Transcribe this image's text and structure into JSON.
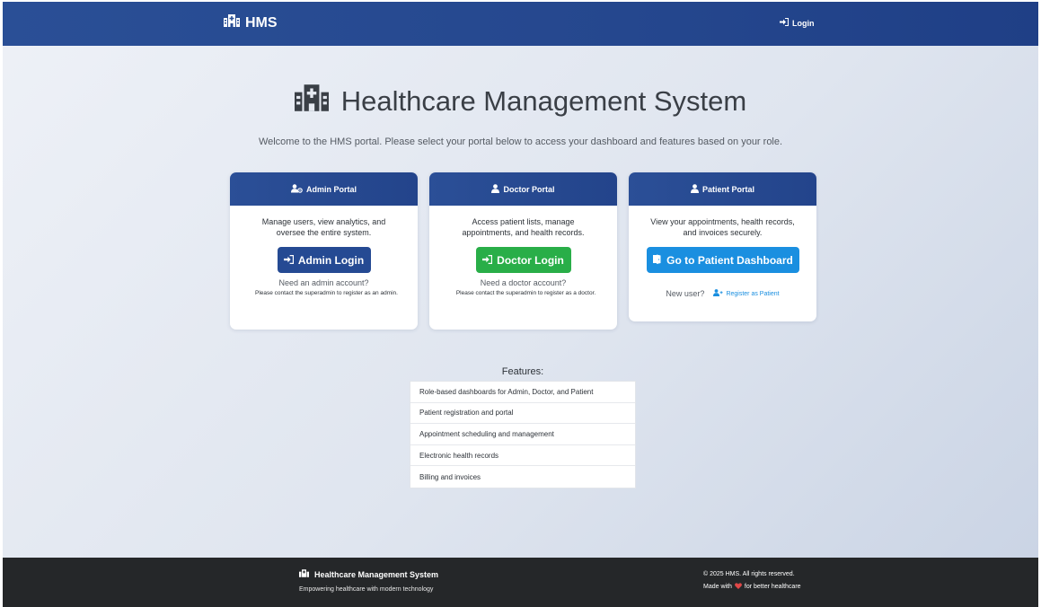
{
  "navbar": {
    "brand": "HMS",
    "brand_icon": "hospital-icon",
    "login_label": "Login",
    "login_icon": "sign-in-icon"
  },
  "hero": {
    "title": "Healthcare Management System",
    "subtitle": "Welcome to the HMS portal. Please select your portal below to access your dashboard and features based on your role."
  },
  "cards": {
    "admin": {
      "header": "Admin Portal",
      "icon": "user-gear-icon",
      "description": "Manage users, view analytics, and oversee the entire system.",
      "button_label": "Admin Login",
      "note": "Need an admin account?",
      "small": "Please contact the superadmin to register as an admin."
    },
    "doctor": {
      "header": "Doctor Portal",
      "icon": "user-doctor-icon",
      "description": "Access patient lists, manage appointments, and health records.",
      "button_label": "Doctor Login",
      "note": "Need a doctor account?",
      "small": "Please contact the superadmin to register as a doctor."
    },
    "patient": {
      "header": "Patient Portal",
      "icon": "user-icon",
      "description": "View your appointments, health records, and invoices securely.",
      "button_label": "Go to Patient Dashboard",
      "new_user": "New user?",
      "register_label": "Register as Patient"
    }
  },
  "features": {
    "title": "Features:",
    "items": [
      "Role-based dashboards for Admin, Doctor, and Patient",
      "Patient registration and portal",
      "Appointment scheduling and management",
      "Electronic health records",
      "Billing and invoices"
    ]
  },
  "footer": {
    "title": "Healthcare Management System",
    "tagline": "Empowering healthcare with modern technology",
    "copyright": "© 2025 HMS. All rights reserved.",
    "made_with_prefix": "Made with",
    "made_with_suffix": "for better healthcare"
  },
  "colors": {
    "primary": "#254a93",
    "success": "#29ae48",
    "info": "#1a8fe0",
    "footer": "#252729"
  }
}
